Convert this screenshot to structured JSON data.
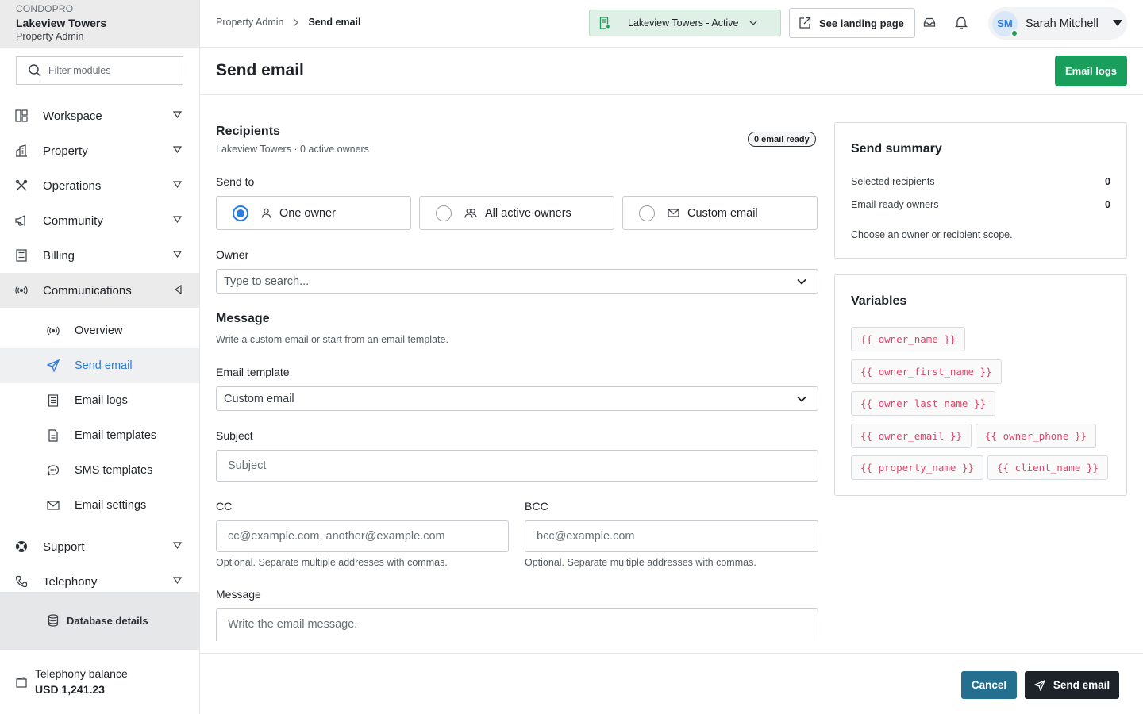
{
  "brand": {
    "org": "CONDOPRO",
    "property": "Lakeview Towers",
    "role": "Property Admin"
  },
  "sidebar": {
    "filter_placeholder": "Filter modules",
    "items": [
      {
        "label": "Workspace",
        "icon": "workspace-icon"
      },
      {
        "label": "Property",
        "icon": "building-icon"
      },
      {
        "label": "Operations",
        "icon": "tools-icon"
      },
      {
        "label": "Community",
        "icon": "megaphone-icon"
      },
      {
        "label": "Billing",
        "icon": "billing-icon"
      },
      {
        "label": "Communications",
        "icon": "broadcast-icon"
      }
    ],
    "sub_items": [
      {
        "label": "Overview",
        "icon": "broadcast-icon"
      },
      {
        "label": "Send email",
        "icon": "send-icon"
      },
      {
        "label": "Email logs",
        "icon": "log-icon"
      },
      {
        "label": "Email templates",
        "icon": "template-icon"
      },
      {
        "label": "SMS templates",
        "icon": "chat-icon"
      },
      {
        "label": "Email settings",
        "icon": "mail-settings-icon"
      }
    ],
    "lower_items": [
      {
        "label": "Support",
        "icon": "lifebuoy-icon"
      },
      {
        "label": "Telephony",
        "icon": "phone-icon"
      }
    ],
    "db_details": "Database details",
    "balance_label": "Telephony balance",
    "balance_value": "USD 1,241.23"
  },
  "topbar": {
    "crumb_parent": "Property Admin",
    "crumb_current": "Send email",
    "property_select": "Lakeview Towers - Active",
    "landing_btn": "See landing page",
    "user_initials": "SM",
    "user_name": "Sarah Mitchell"
  },
  "page": {
    "title": "Send email",
    "logs_btn": "Email logs"
  },
  "recipients": {
    "title": "Recipients",
    "subtitle": "Lakeview Towers · 0 active owners",
    "badge": "0 email ready",
    "send_to_label": "Send to",
    "options": [
      "One owner",
      "All active owners",
      "Custom email"
    ],
    "selected": 0,
    "owner_label": "Owner",
    "owner_placeholder": "Type to search..."
  },
  "message": {
    "title": "Message",
    "subtitle": "Write a custom email or start from an email template.",
    "template_label": "Email template",
    "template_value": "Custom email",
    "subject_label": "Subject",
    "subject_placeholder": "Subject",
    "cc_label": "CC",
    "cc_placeholder": "cc@example.com, another@example.com",
    "cc_help": "Optional. Separate multiple addresses with commas.",
    "bcc_label": "BCC",
    "bcc_placeholder": "bcc@example.com",
    "bcc_help": "Optional. Separate multiple addresses with commas.",
    "message_label": "Message",
    "message_placeholder": "Write the email message."
  },
  "summary": {
    "title": "Send summary",
    "rows": [
      {
        "label": "Selected recipients",
        "value": "0"
      },
      {
        "label": "Email-ready owners",
        "value": "0"
      }
    ],
    "note": "Choose an owner or recipient scope."
  },
  "variables": {
    "title": "Variables",
    "chips": [
      "{{ owner_name }}",
      "{{ owner_first_name }}",
      "{{ owner_last_name }}",
      "{{ owner_email }}",
      "{{ owner_phone }}",
      "{{ property_name }}",
      "{{ client_name }}"
    ]
  },
  "footer": {
    "cancel": "Cancel",
    "send": "Send email"
  },
  "colors": {
    "accent": "#2c7be5",
    "success": "#1a9e5c",
    "cancel": "#246e8f",
    "dark": "#1e2329",
    "variable": "#e0446a"
  }
}
